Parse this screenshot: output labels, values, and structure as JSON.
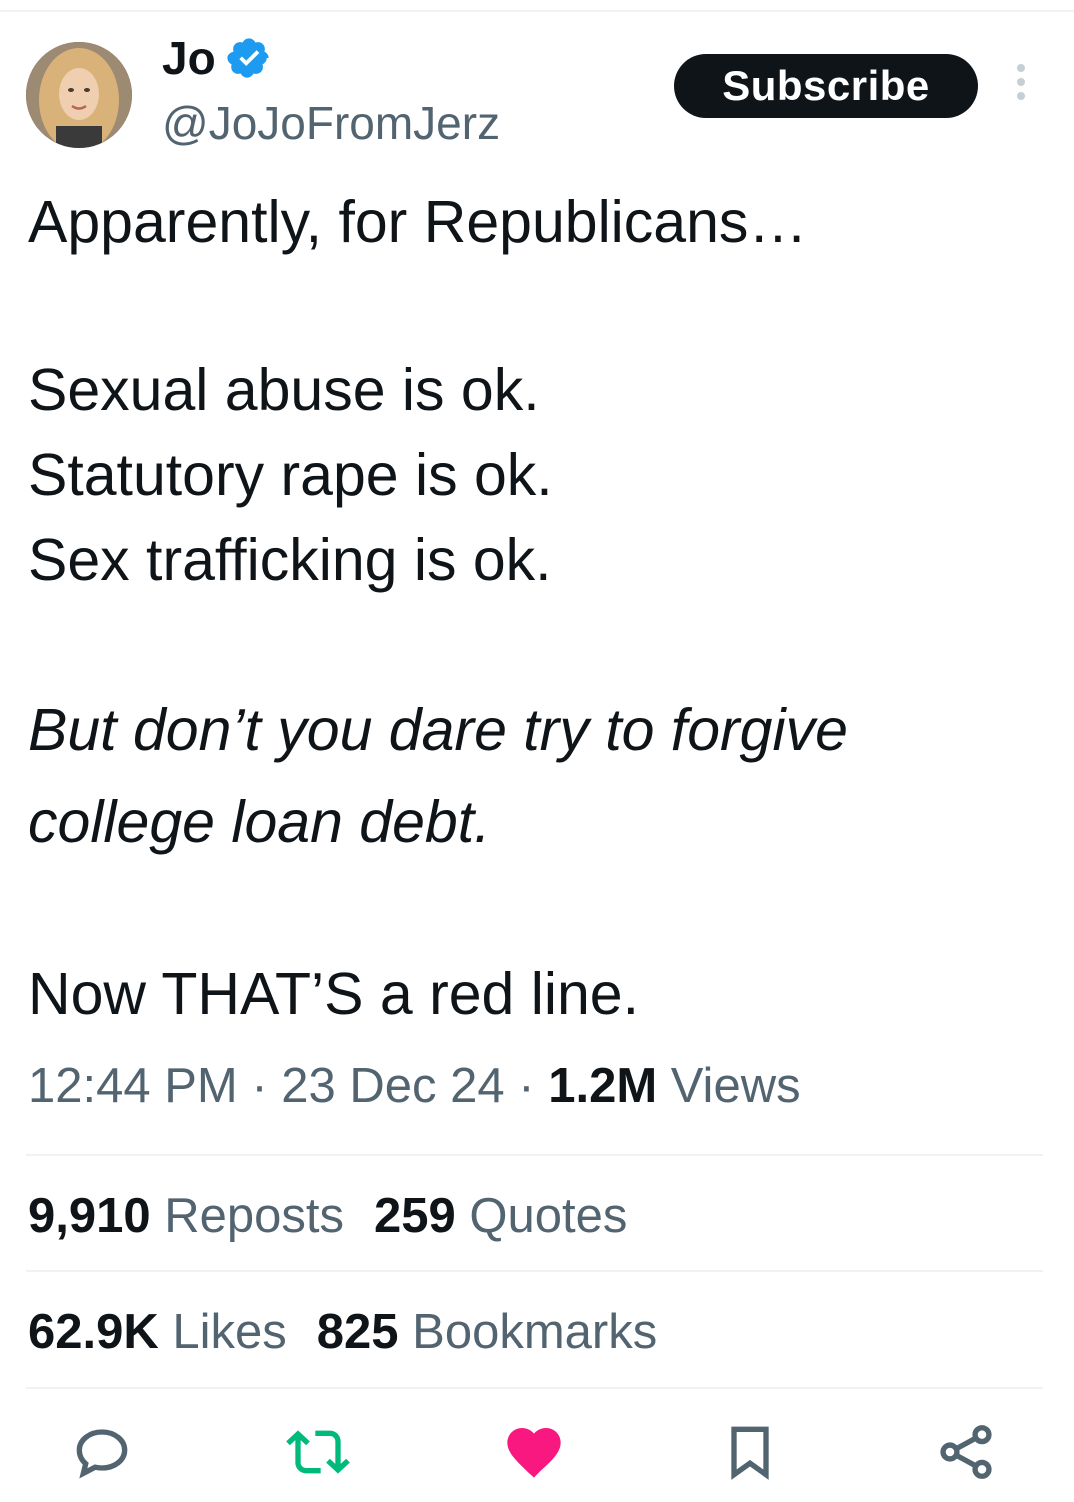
{
  "author": {
    "display_name": "Jo",
    "handle": "@JoJoFromJerz",
    "verified_badge_color": "#1d9bf0"
  },
  "header": {
    "subscribe_label": "Subscribe"
  },
  "tweet": {
    "lines": [
      "Apparently, for Republicans…",
      "Sexual abuse is ok.",
      "Statutory rape is ok.",
      "Sex trafficking is ok.",
      "But don’t you dare try to forgive",
      "college loan debt.",
      "Now THAT’S a red line."
    ]
  },
  "meta": {
    "time": "12:44 PM",
    "separator": " · ",
    "date": "23 Dec 24",
    "views_count": "1.2M",
    "views_label": " Views"
  },
  "stats": {
    "reposts_count": "9,910",
    "reposts_label": "Reposts",
    "quotes_count": "259",
    "quotes_label": "Quotes",
    "likes_count": "62.9K",
    "likes_label": "Likes",
    "bookmarks_count": "825",
    "bookmarks_label": "Bookmarks"
  },
  "actions": {
    "icons": [
      "reply-icon",
      "repost-icon",
      "like-icon",
      "bookmark-icon",
      "share-icon"
    ],
    "repost_color": "#00ba7c",
    "like_color": "#f91880",
    "default_color": "#536471"
  }
}
